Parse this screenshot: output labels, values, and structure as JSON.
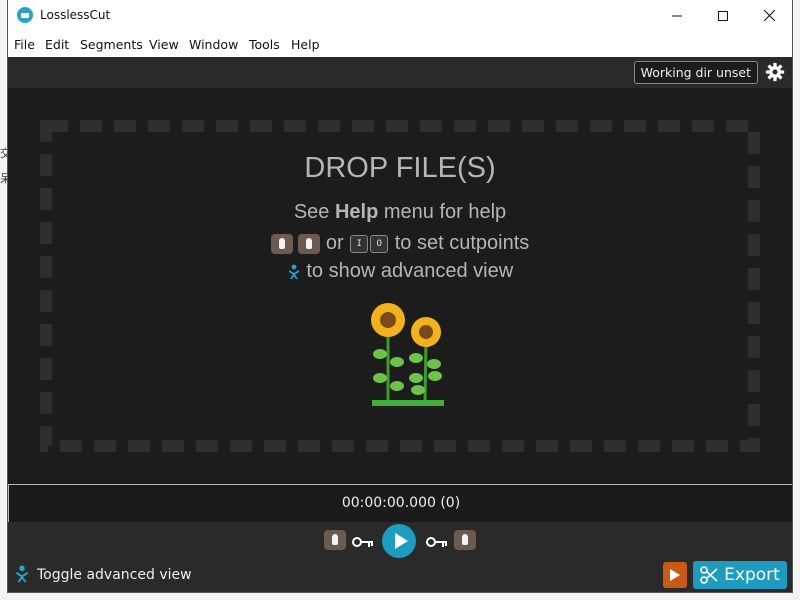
{
  "window": {
    "title": "LosslessCut"
  },
  "menu": [
    "File",
    "Edit",
    "Segments",
    "View",
    "Window",
    "Tools",
    "Help"
  ],
  "toolbar": {
    "working_dir_label": "Working dir unset"
  },
  "dropzone": {
    "title": "DROP FILE(S)",
    "help_prefix": "See ",
    "help_bold": "Help",
    "help_suffix": " menu for help",
    "cutpoints_or": "or",
    "key_in": "I",
    "key_out": "O",
    "cutpoints_suffix": "to set cutpoints",
    "advanced_suffix": "to show advanced view"
  },
  "timeline": {
    "timecode": "00:00:00.000 (0)"
  },
  "bottom": {
    "toggle_label": "Toggle advanced view",
    "export_label": "Export"
  },
  "colors": {
    "accent": "#1e9cc0",
    "background": "#1c1c1c",
    "export_play": "#c85a16"
  }
}
